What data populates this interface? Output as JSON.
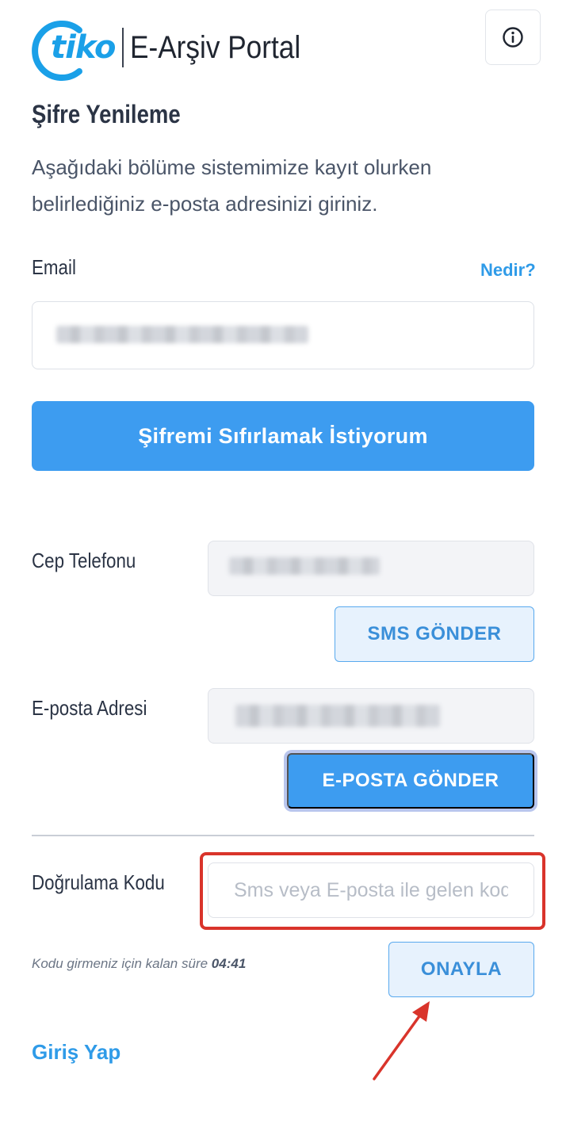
{
  "header": {
    "logo_brand": "tiko",
    "app_title": "E-Arşiv Portal",
    "info_icon": "info-circle-icon"
  },
  "reset": {
    "title": "Şifre Yenileme",
    "intro_line1": "Aşağıdaki bölüme sistemimize kayıt olurken",
    "intro_line2": "belirlediğiniz e-posta adresinizi giriniz.",
    "email_label": "Email",
    "email_help_link": "Nedir?",
    "submit_label": "Şifremi Sıfırlamak İstiyorum"
  },
  "verification": {
    "phone_label": "Cep Telefonu",
    "sms_button": "SMS GÖNDER",
    "email_label": "E-posta Adresi",
    "email_button": "E-POSTA GÖNDER",
    "code_label": "Doğrulama Kodu",
    "code_placeholder": "Sms veya E-posta ile gelen kod",
    "timer_text": "Kodu girmeniz için kalan süre",
    "timer_value": "04:41",
    "confirm_button": "ONAYLA"
  },
  "footer": {
    "login_link": "Giriş Yap"
  },
  "colors": {
    "primary": "#3d9cf0",
    "link": "#2f9be8",
    "brand": "#1aa0e8",
    "highlight": "#d9342b"
  }
}
